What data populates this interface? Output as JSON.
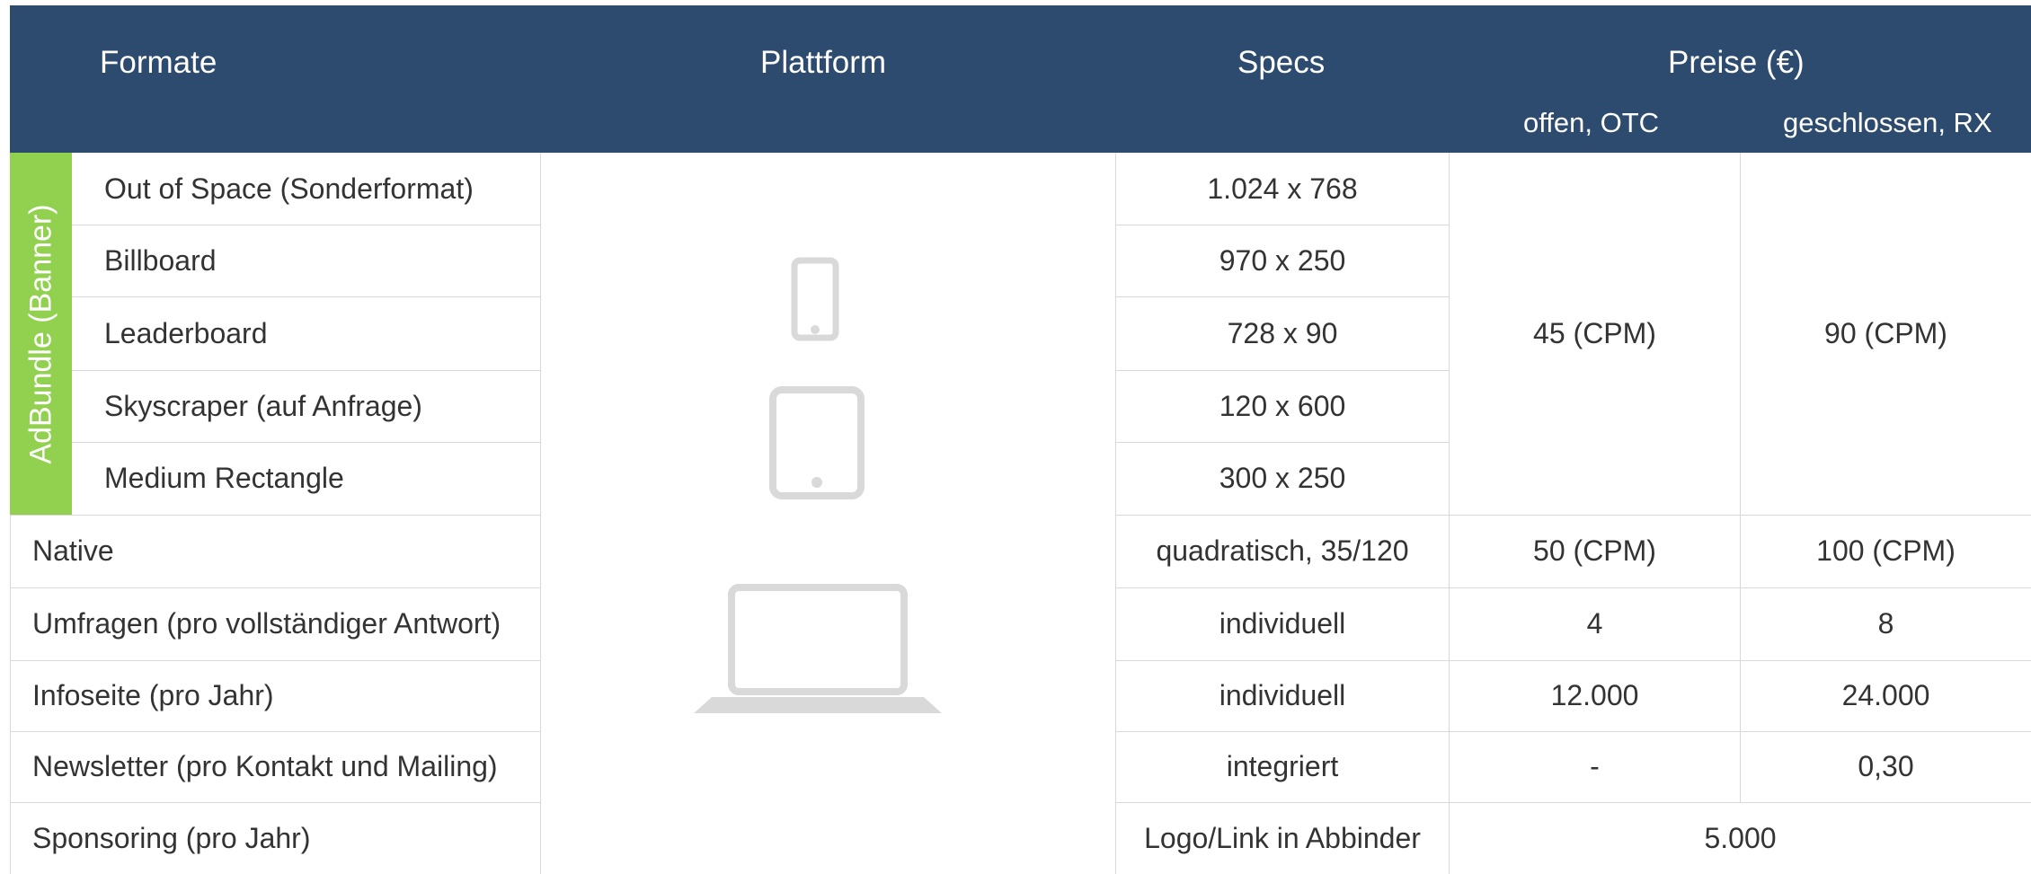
{
  "header": {
    "col_formate": "Formate",
    "col_plattform": "Plattform",
    "col_specs": "Specs",
    "col_preise": "Preise (€)",
    "sub_offen": "offen, OTC",
    "sub_geschlossen": "geschlossen, RX"
  },
  "group": {
    "label": "AdBundle (Banner)",
    "color": "#92d050"
  },
  "bundle_rows": [
    {
      "format": "Out of Space (Sonderformat)",
      "spec": "1.024 x 768"
    },
    {
      "format": "Billboard",
      "spec": "970 x 250"
    },
    {
      "format": "Leaderboard",
      "spec": "728 x 90"
    },
    {
      "format": "Skyscraper (auf Anfrage)",
      "spec": "120 x 600"
    },
    {
      "format": "Medium Rectangle",
      "spec": "300 x 250"
    }
  ],
  "bundle_prices": {
    "offen": "45 (CPM)",
    "geschlossen": "90 (CPM)"
  },
  "rows": [
    {
      "format": "Native",
      "spec": "quadratisch, 35/120",
      "offen": "50 (CPM)",
      "geschlossen": "100 (CPM)"
    },
    {
      "format": "Umfragen (pro vollständiger Antwort)",
      "spec": "individuell",
      "offen": "4",
      "geschlossen": "8"
    },
    {
      "format": "Infoseite (pro Jahr)",
      "spec": "individuell",
      "offen": "12.000",
      "geschlossen": "24.000"
    },
    {
      "format": "Newsletter (pro Kontakt und Mailing)",
      "spec": "integriert",
      "offen": "-",
      "geschlossen": "0,30"
    }
  ],
  "sponsoring": {
    "format": "Sponsoring (pro Jahr)",
    "spec": "Logo/Link in Abbinder",
    "price": "5.000"
  },
  "platform_icons": [
    "smartphone-icon",
    "tablet-icon",
    "laptop-icon"
  ],
  "colors": {
    "header_bg": "#2d4b6e",
    "accent_green": "#92d050",
    "icon_gray": "#d9d9d9"
  }
}
